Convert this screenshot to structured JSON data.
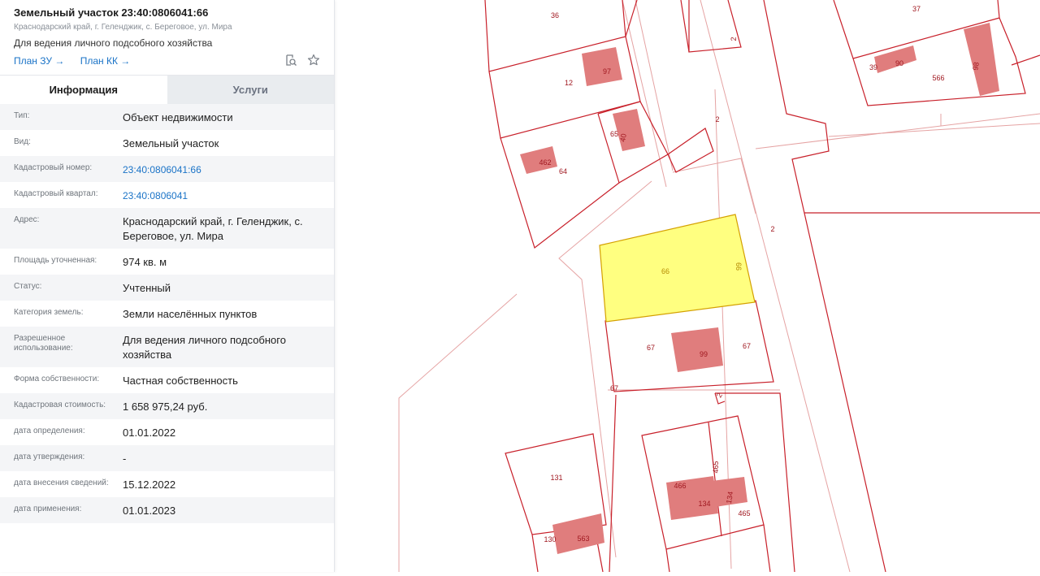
{
  "header": {
    "title": "Земельный участок 23:40:0806041:66",
    "address": "Краснодарский край, г. Геленджик, с. Береговое, ул. Мира",
    "purpose": "Для ведения личного подсобного хозяйства",
    "plan_zu": "План ЗУ →",
    "plan_kk": "План КК →",
    "icons": [
      "search-document-icon",
      "star-icon"
    ]
  },
  "tabs": {
    "info": "Информация",
    "services": "Услуги"
  },
  "rows": [
    {
      "label": "Тип:",
      "value": "Объект недвижимости"
    },
    {
      "label": "Вид:",
      "value": "Земельный участок"
    },
    {
      "label": "Кадастровый номер:",
      "value": "23:40:0806041:66"
    },
    {
      "label": "Кадастровый квартал:",
      "value": "23:40:0806041"
    },
    {
      "label": "Адрес:",
      "value": "Краснодарский край, г. Геленджик, с. Береговое, ул. Мира"
    },
    {
      "label": "Площадь уточненная:",
      "value": "974 кв. м"
    },
    {
      "label": "Статус:",
      "value": "Учтенный"
    },
    {
      "label": "Категория земель:",
      "value": "Земли населённых пунктов"
    },
    {
      "label": "Разрешенное использование:",
      "value": "Для ведения личного подсобного хозяйства"
    },
    {
      "label": "Форма собственности:",
      "value": "Частная собственность"
    },
    {
      "label": "Кадастровая стоимость:",
      "value": "1 658 975,24 руб."
    },
    {
      "label": "дата определения:",
      "value": "01.01.2022"
    },
    {
      "label": "дата утверждения:",
      "value": "-"
    },
    {
      "label": "дата внесения сведений:",
      "value": "15.12.2022"
    },
    {
      "label": "дата применения:",
      "value": "01.01.2023"
    }
  ],
  "map": {
    "colors": {
      "border": "#c8202a",
      "building": "#e07d7d",
      "selected": "#ffff80",
      "selected_border": "#d4a000",
      "thin": "#e5a3a3"
    },
    "labels": [
      "36",
      "37",
      "97",
      "12",
      "39",
      "90",
      "566",
      "98",
      "65",
      "40",
      "2",
      "462",
      "64",
      "2",
      "2",
      "66",
      "66",
      "67",
      "99",
      "67",
      "67",
      "2",
      "131",
      "466",
      "465",
      "134",
      "134",
      "465",
      "130",
      "563"
    ]
  }
}
